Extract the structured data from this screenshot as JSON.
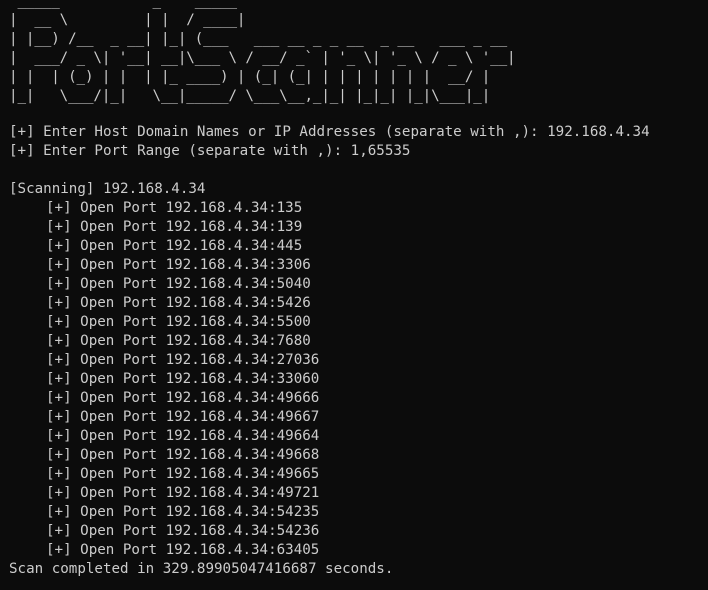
{
  "banner": " _____           _    _____\n|  __ \\         | |  / ____|\n| |__) /__  _ __| |_| (___   ___ __ _ _ __  _ __   ___ _ __\n|  ___/ _ \\| '__| __|\\___ \\ / __/ _` | '_ \\| '_ \\ / _ \\ '__|\n| |  | (_) | |  | |_ ____) | (_| (_| | | | | | | |  __/ |\n|_|   \\___/|_|   \\__|_____/ \\___\\__,_|_| |_|_| |_|\\___|_|",
  "prompts": {
    "host": "[+] Enter Host Domain Names or IP Addresses (separate with ,): 192.168.4.34",
    "range": "[+] Enter Port Range (separate with ,): 1,65535"
  },
  "scan_header": "[Scanning] 192.168.4.34",
  "open_ports": [
    "[+] Open Port 192.168.4.34:135",
    "[+] Open Port 192.168.4.34:139",
    "[+] Open Port 192.168.4.34:445",
    "[+] Open Port 192.168.4.34:3306",
    "[+] Open Port 192.168.4.34:5040",
    "[+] Open Port 192.168.4.34:5426",
    "[+] Open Port 192.168.4.34:5500",
    "[+] Open Port 192.168.4.34:7680",
    "[+] Open Port 192.168.4.34:27036",
    "[+] Open Port 192.168.4.34:33060",
    "[+] Open Port 192.168.4.34:49666",
    "[+] Open Port 192.168.4.34:49667",
    "[+] Open Port 192.168.4.34:49664",
    "[+] Open Port 192.168.4.34:49668",
    "[+] Open Port 192.168.4.34:49665",
    "[+] Open Port 192.168.4.34:49721",
    "[+] Open Port 192.168.4.34:54235",
    "[+] Open Port 192.168.4.34:54236",
    "[+] Open Port 192.168.4.34:63405"
  ],
  "completion": "Scan completed in 329.89905047416687 seconds.",
  "colors": {
    "background": "#0c0c0c",
    "foreground": "#cccccc"
  }
}
